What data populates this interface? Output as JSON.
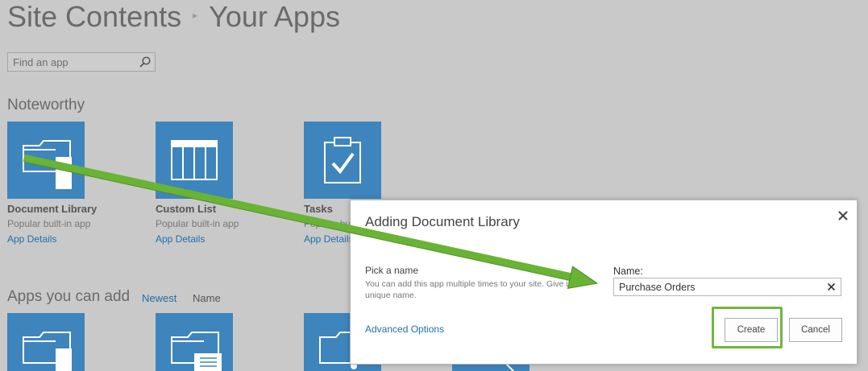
{
  "header": {
    "crumb1": "Site Contents",
    "crumb2": "Your Apps"
  },
  "search": {
    "placeholder": "Find an app"
  },
  "sections": {
    "noteworthy": "Noteworthy",
    "apps_you_can_add": "Apps you can add"
  },
  "sort": {
    "newest": "Newest",
    "name": "Name"
  },
  "noteworthy_tiles": [
    {
      "name": "Document Library",
      "desc": "Popular built-in app",
      "link": "App Details",
      "icon": "document-library-icon"
    },
    {
      "name": "Custom List",
      "desc": "Popular built-in app",
      "link": "App Details",
      "icon": "custom-list-icon"
    },
    {
      "name": "Tasks",
      "desc": "Popular built-in app",
      "link": "App Details",
      "icon": "tasks-icon"
    }
  ],
  "dialog": {
    "title": "Adding Document Library",
    "pick_label": "Pick a name",
    "pick_help": "You can add this app multiple times to your site. Give it a unique name.",
    "name_label": "Name:",
    "name_value": "Purchase Orders",
    "advanced_options": "Advanced Options",
    "create": "Create",
    "cancel": "Cancel"
  },
  "colors": {
    "tile": "#3e85bd",
    "link": "#1f6fa8",
    "annotation_green": "#5fa52a",
    "background": "#c9c9c9"
  }
}
